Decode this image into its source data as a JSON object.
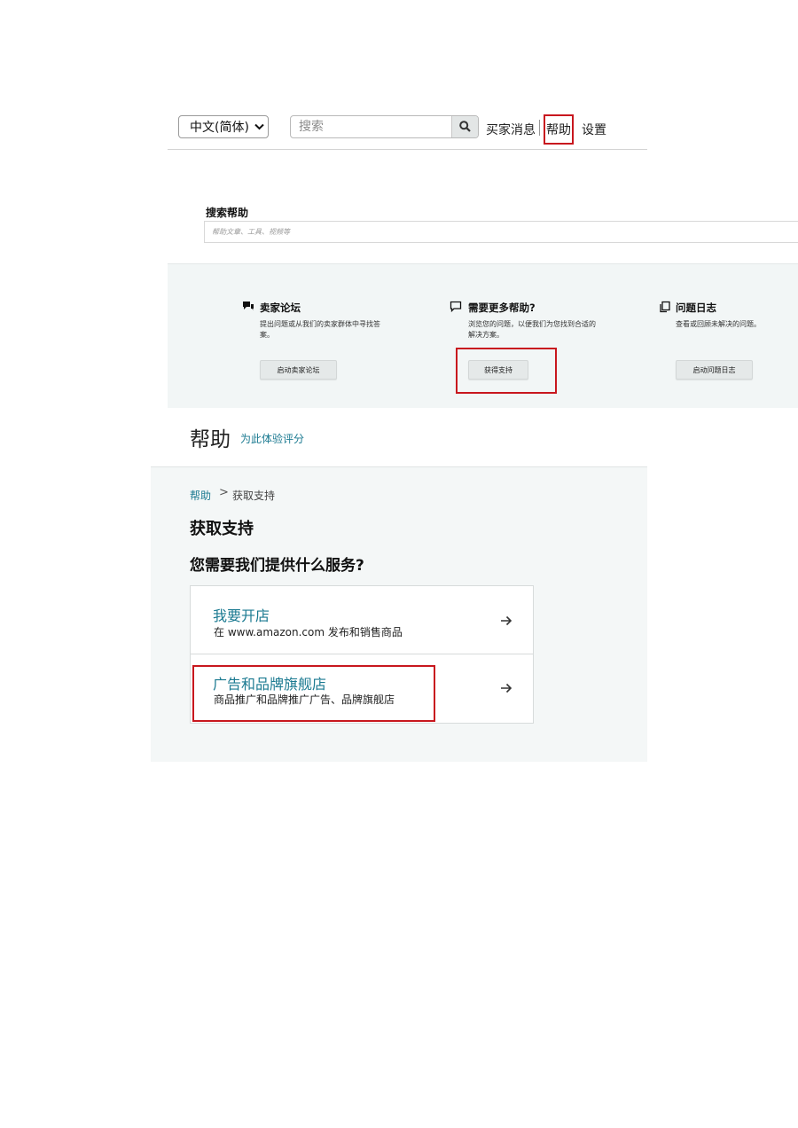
{
  "nav": {
    "language_selected": "中文(简体)",
    "search_placeholder": "搜索",
    "buyer_messages": "买家消息",
    "help": "帮助",
    "settings": "设置"
  },
  "search_help": {
    "title": "搜索帮助",
    "placeholder": "帮助文章、工具、视频等"
  },
  "help_cards": [
    {
      "icon": "forum-icon",
      "title": "卖家论坛",
      "description": "提出问题或从我们的卖家群体中寻找答案。",
      "button": "启动卖家论坛"
    },
    {
      "icon": "speech-bubble-icon",
      "title": "需要更多帮助?",
      "description": "浏览您的问题，以便我们为您找到合适的解决方案。",
      "button": "获得支持"
    },
    {
      "icon": "copy-icon",
      "title": "问题日志",
      "description": "查看或回顾未解决的问题。",
      "button": "启动问题日志"
    }
  ],
  "help_header": {
    "title": "帮助",
    "rate_link": "为此体验评分"
  },
  "support": {
    "breadcrumb_root": "帮助",
    "breadcrumb_separator": ">",
    "breadcrumb_current": "获取支持",
    "page_title": "获取支持",
    "question": "您需要我们提供什么服务?",
    "options": [
      {
        "title": "我要开店",
        "description": "在 www.amazon.com 发布和销售商品",
        "icon": "arrow-right-icon"
      },
      {
        "title": "广告和品牌旗舰店",
        "description": "商品推广和品牌推广广告、品牌旗舰店",
        "icon": "arrow-right-icon"
      }
    ]
  },
  "colors": {
    "highlight": "#c8171e",
    "link": "#1b7a91",
    "panel_bg": "#f2f6f6"
  }
}
